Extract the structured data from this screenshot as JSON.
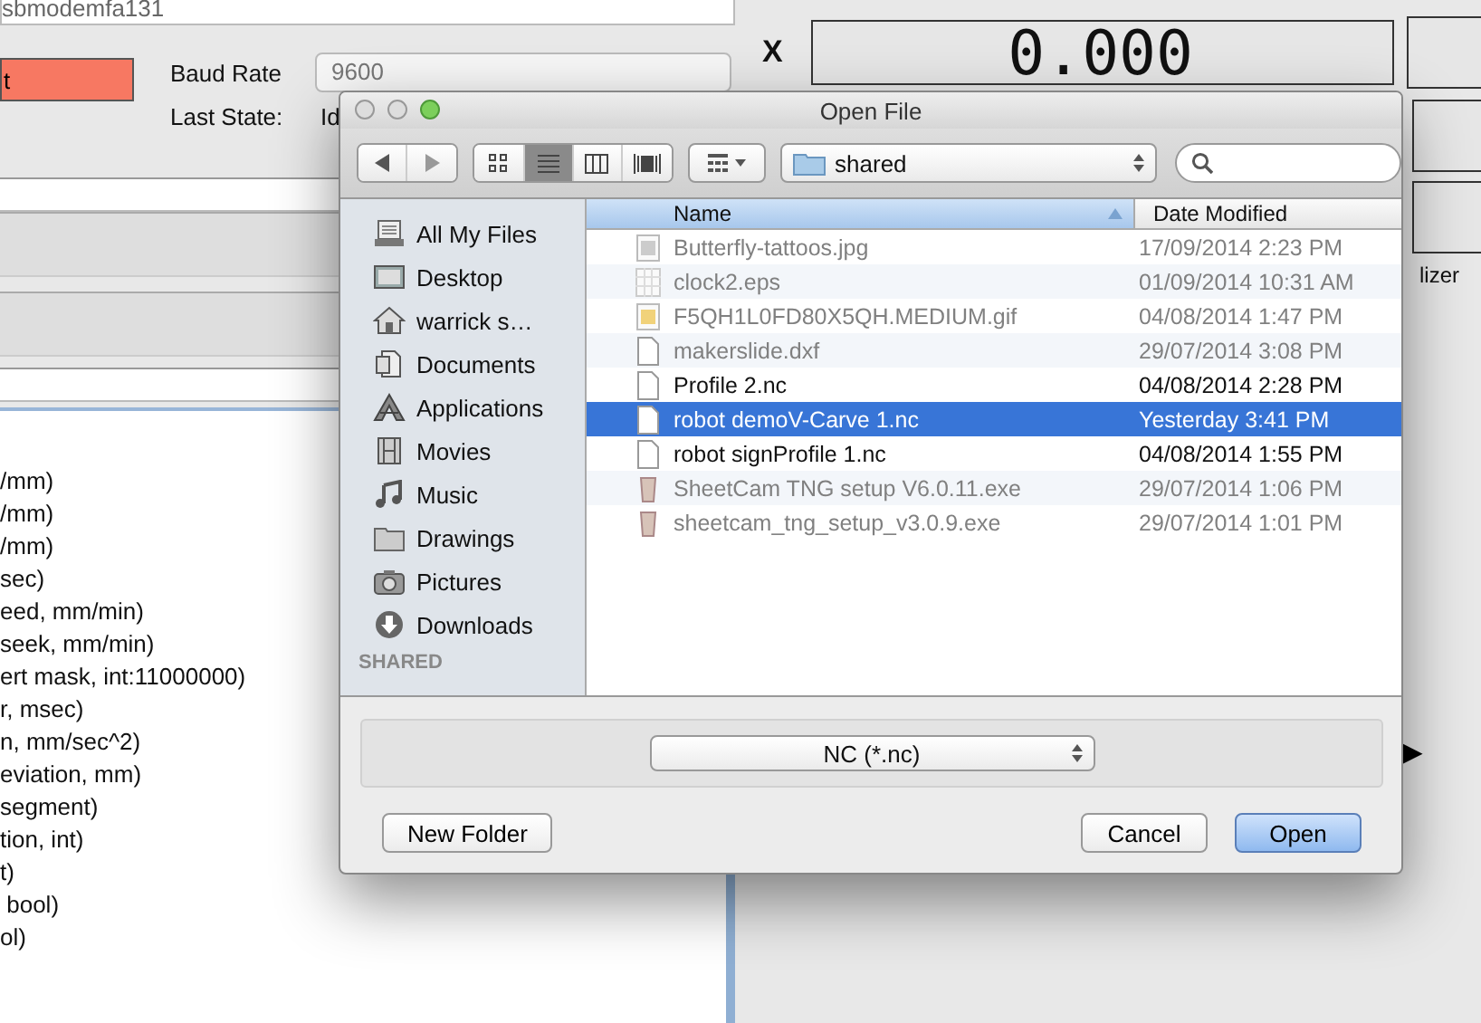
{
  "background": {
    "port_field": "sbmodemfa131",
    "connect_button": "t",
    "baud_rate_label": "Baud Rate",
    "baud_rate": "9600",
    "last_state_label": "Last State:",
    "last_state": "Id",
    "axis_label": "X",
    "coordinate": "0.000",
    "tab_fragment": "lizer",
    "play_button": "▶",
    "settings_lines": [
      "/mm)",
      "/mm)",
      "/mm)",
      "sec)",
      "eed, mm/min)",
      "seek, mm/min)",
      "ert mask, int:11000000)",
      "r, msec)",
      "n, mm/sec^2)",
      "eviation, mm)",
      "segment)",
      "tion, int)",
      "t)",
      " bool)",
      "ol)"
    ]
  },
  "dialog": {
    "title": "Open File",
    "view_modes": [
      {
        "kind": "icons",
        "selected": false
      },
      {
        "kind": "list",
        "selected": true
      },
      {
        "kind": "columns",
        "selected": false
      },
      {
        "kind": "coverflow",
        "selected": false
      }
    ],
    "location": "shared",
    "sidebar": {
      "items": [
        {
          "kind": "files",
          "label": "All My Files"
        },
        {
          "kind": "desktop",
          "label": "Desktop"
        },
        {
          "kind": "home",
          "label": "warrick s…"
        },
        {
          "kind": "documents",
          "label": "Documents"
        },
        {
          "kind": "applications",
          "label": "Applications"
        },
        {
          "kind": "movies",
          "label": "Movies"
        },
        {
          "kind": "music",
          "label": "Music"
        },
        {
          "kind": "folder",
          "label": "Drawings"
        },
        {
          "kind": "pictures",
          "label": "Pictures"
        },
        {
          "kind": "downloads",
          "label": "Downloads"
        }
      ],
      "section": "SHARED"
    },
    "columns": [
      "Name",
      "Date Modified"
    ],
    "files": [
      {
        "kind": "image",
        "name": "Butterfly-tattoos.jpg",
        "date": "17/09/2014 2:23 PM",
        "disabled": true,
        "selected": false
      },
      {
        "kind": "sheet",
        "name": "clock2.eps",
        "date": "01/09/2014 10:31 AM",
        "disabled": true,
        "selected": false
      },
      {
        "kind": "gif",
        "name": "F5QH1L0FD80X5QH.MEDIUM.gif",
        "date": "04/08/2014 1:47 PM",
        "disabled": true,
        "selected": false
      },
      {
        "kind": "document",
        "name": "makerslide.dxf",
        "date": "29/07/2014 3:08 PM",
        "disabled": true,
        "selected": false
      },
      {
        "kind": "document",
        "name": "Profile 2.nc",
        "date": "04/08/2014 2:28 PM",
        "disabled": false,
        "selected": false
      },
      {
        "kind": "document",
        "name": "robot demoV-Carve 1.nc",
        "date": "Yesterday 3:41 PM",
        "disabled": false,
        "selected": true
      },
      {
        "kind": "document",
        "name": "robot signProfile 1.nc",
        "date": "04/08/2014 1:55 PM",
        "disabled": false,
        "selected": false
      },
      {
        "kind": "installer",
        "name": "SheetCam TNG setup V6.0.11.exe",
        "date": "29/07/2014 1:06 PM",
        "disabled": true,
        "selected": false
      },
      {
        "kind": "installer",
        "name": "sheetcam_tng_setup_v3.0.9.exe",
        "date": "29/07/2014 1:01 PM",
        "disabled": true,
        "selected": false
      }
    ],
    "format": "NC (*.nc)",
    "buttons": [
      {
        "kind": "new-folder",
        "label": "New Folder"
      },
      {
        "kind": "cancel",
        "label": "Cancel"
      },
      {
        "kind": "open",
        "label": "Open"
      }
    ]
  }
}
